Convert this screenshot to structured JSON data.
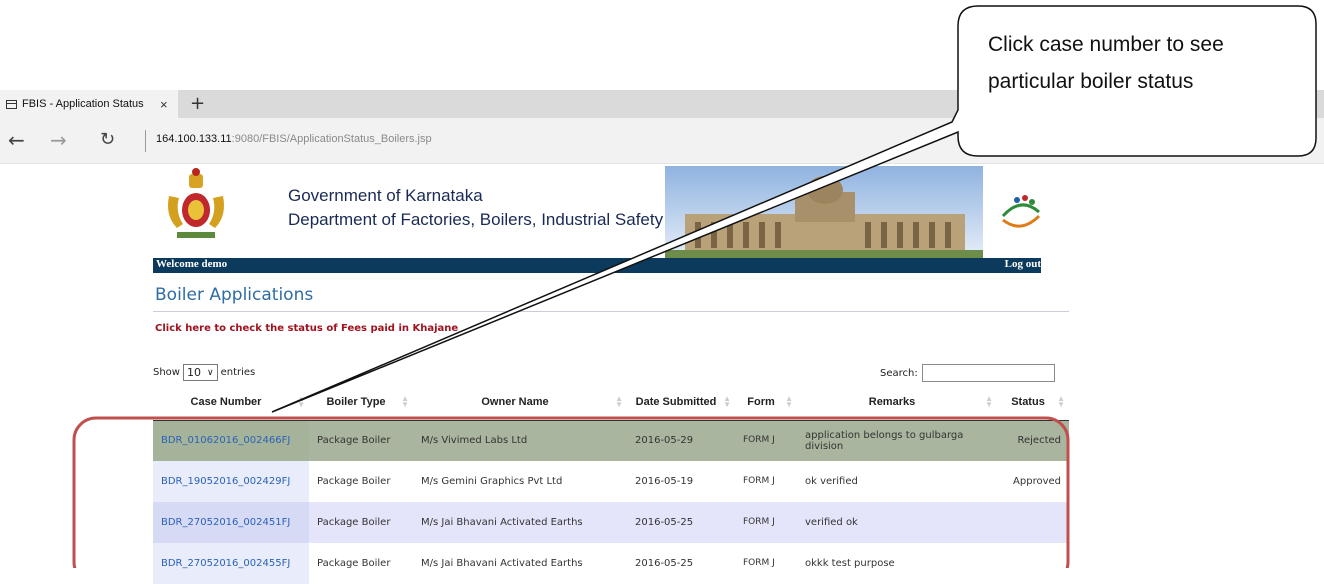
{
  "browser": {
    "tab_title": "FBIS - Application Status",
    "tab_close": "×",
    "new_tab": "+",
    "url_host": "164.100.133.11",
    "url_rest": ":9080/FBIS/ApplicationStatus_Boilers.jsp"
  },
  "header": {
    "gov_name": "Government of Karnataka",
    "dept_name": "Department of Factories, Boilers, Industrial Safety & Health",
    "welcome": "Welcome demo",
    "logout": "Log out"
  },
  "page": {
    "title": "Boiler Applications",
    "fees_link": "Click here to check the status of Fees paid in Khajane"
  },
  "table_controls": {
    "show_label": "Show",
    "entries_value": "10",
    "entries_label": "entries",
    "search_label": "Search:",
    "search_value": ""
  },
  "table": {
    "columns": [
      "Case Number",
      "Boiler Type",
      "Owner Name",
      "Date Submitted",
      "Form",
      "Remarks",
      "Status"
    ],
    "rows": [
      {
        "case": "BDR_01062016_002466FJ",
        "type": "Package Boiler",
        "owner": "M/s Vivimed Labs Ltd",
        "date": "2016-05-29",
        "form": "FORM J",
        "remarks": "application belongs to gulbarga division",
        "status": "Rejected"
      },
      {
        "case": "BDR_19052016_002429FJ",
        "type": "Package Boiler",
        "owner": "M/s Gemini Graphics Pvt Ltd",
        "date": "2016-05-19",
        "form": "FORM J",
        "remarks": "ok verified",
        "status": "Approved"
      },
      {
        "case": "BDR_27052016_002451FJ",
        "type": "Package Boiler",
        "owner": "M/s Jai Bhavani Activated Earths",
        "date": "2016-05-25",
        "form": "FORM J",
        "remarks": "verified ok",
        "status": ""
      },
      {
        "case": "BDR_27052016_002455FJ",
        "type": "Package Boiler",
        "owner": "M/s Jai Bhavani Activated Earths",
        "date": "2016-05-25",
        "form": "FORM J",
        "remarks": "okkk test purpose",
        "status": ""
      }
    ]
  },
  "annotation": {
    "callout_line1": "Click case number to see",
    "callout_line2": "particular boiler status",
    "highlight_color": "#c0504d"
  }
}
